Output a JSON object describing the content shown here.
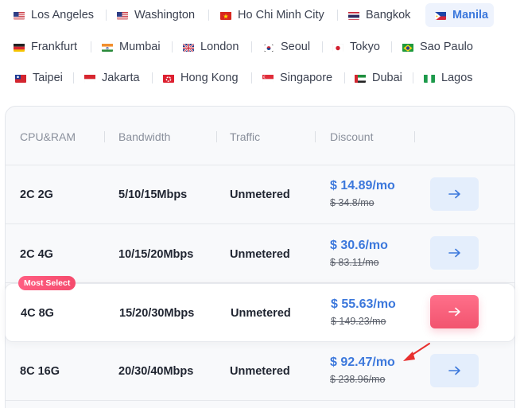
{
  "locations": {
    "rows": [
      [
        {
          "label": "Los Angeles",
          "flag": "us-flag"
        },
        {
          "label": "Washington",
          "flag": "us-flag"
        },
        {
          "label": "Ho Chi Minh City",
          "flag": "vn-flag"
        },
        {
          "label": "Bangkok",
          "flag": "th-flag"
        },
        {
          "label": "Manila",
          "flag": "ph-flag",
          "active": true
        }
      ],
      [
        {
          "label": "Frankfurt",
          "flag": "de-flag"
        },
        {
          "label": "Mumbai",
          "flag": "in-flag"
        },
        {
          "label": "London",
          "flag": "gb-flag"
        },
        {
          "label": "Seoul",
          "flag": "kr-flag"
        },
        {
          "label": "Tokyo",
          "flag": "jp-flag"
        },
        {
          "label": "Sao Paulo",
          "flag": "br-flag"
        }
      ],
      [
        {
          "label": "Taipei",
          "flag": "tw-flag"
        },
        {
          "label": "Jakarta",
          "flag": "id-flag"
        },
        {
          "label": "Hong Kong",
          "flag": "hk-flag"
        },
        {
          "label": "Singapore",
          "flag": "sg-flag"
        },
        {
          "label": "Dubai",
          "flag": "ae-flag"
        },
        {
          "label": "Lagos",
          "flag": "ng-flag"
        }
      ]
    ]
  },
  "table": {
    "headers": {
      "cpu_ram": "CPU&RAM",
      "bandwidth": "Bandwidth",
      "traffic": "Traffic",
      "discount": "Discount"
    },
    "badge": "Most Select",
    "plans": [
      {
        "cpu_ram": "2C 2G",
        "bandwidth": "5/10/15Mbps",
        "traffic": "Unmetered",
        "price": "$ 14.89/mo",
        "old_price": "$ 34.8/mo",
        "action": "arrow-right-icon"
      },
      {
        "cpu_ram": "2C 4G",
        "bandwidth": "10/15/20Mbps",
        "traffic": "Unmetered",
        "price": "$ 30.6/mo",
        "old_price": "$ 83.11/mo",
        "action": "arrow-right-icon"
      },
      {
        "cpu_ram": "4C 8G",
        "bandwidth": "15/20/30Mbps",
        "traffic": "Unmetered",
        "price": "$ 55.63/mo",
        "old_price": "$ 149.23/mo",
        "action": "arrow-right-icon",
        "featured": true
      },
      {
        "cpu_ram": "8C 16G",
        "bandwidth": "20/30/40Mbps",
        "traffic": "Unmetered",
        "price": "$ 92.47/mo",
        "old_price": "$ 238.96/mo",
        "action": "arrow-right-icon"
      }
    ]
  },
  "annotation": {
    "icon": "red-arrow-pointer-icon",
    "color": "#e8302f"
  },
  "colors": {
    "accent": "#3c78dc",
    "hot": "#f2546f",
    "active_tab_bg": "#eef3fd"
  }
}
